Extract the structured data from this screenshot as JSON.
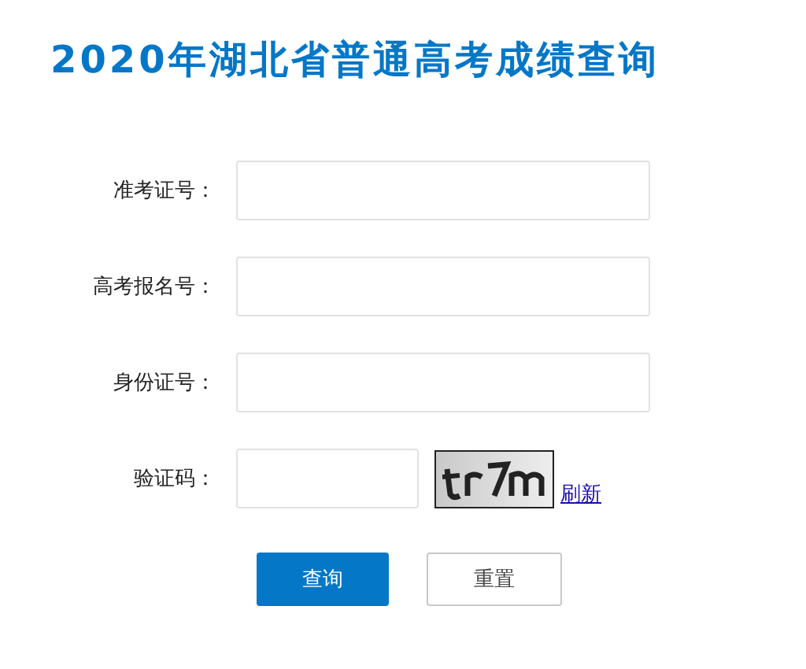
{
  "title": "2020年湖北省普通高考成绩查询",
  "fields": [
    {
      "label": "准考证号：",
      "kind": "wide"
    },
    {
      "label": "高考报名号：",
      "kind": "wide"
    },
    {
      "label": "身份证号：",
      "kind": "wide"
    },
    {
      "label": "验证码：",
      "kind": "captcha"
    }
  ],
  "captcha": {
    "kind": "picture",
    "refresh_link": "刷新"
  },
  "buttons": [
    {
      "label": "查询",
      "kind": "primary"
    },
    {
      "label": "重置",
      "kind": "secondary"
    }
  ]
}
